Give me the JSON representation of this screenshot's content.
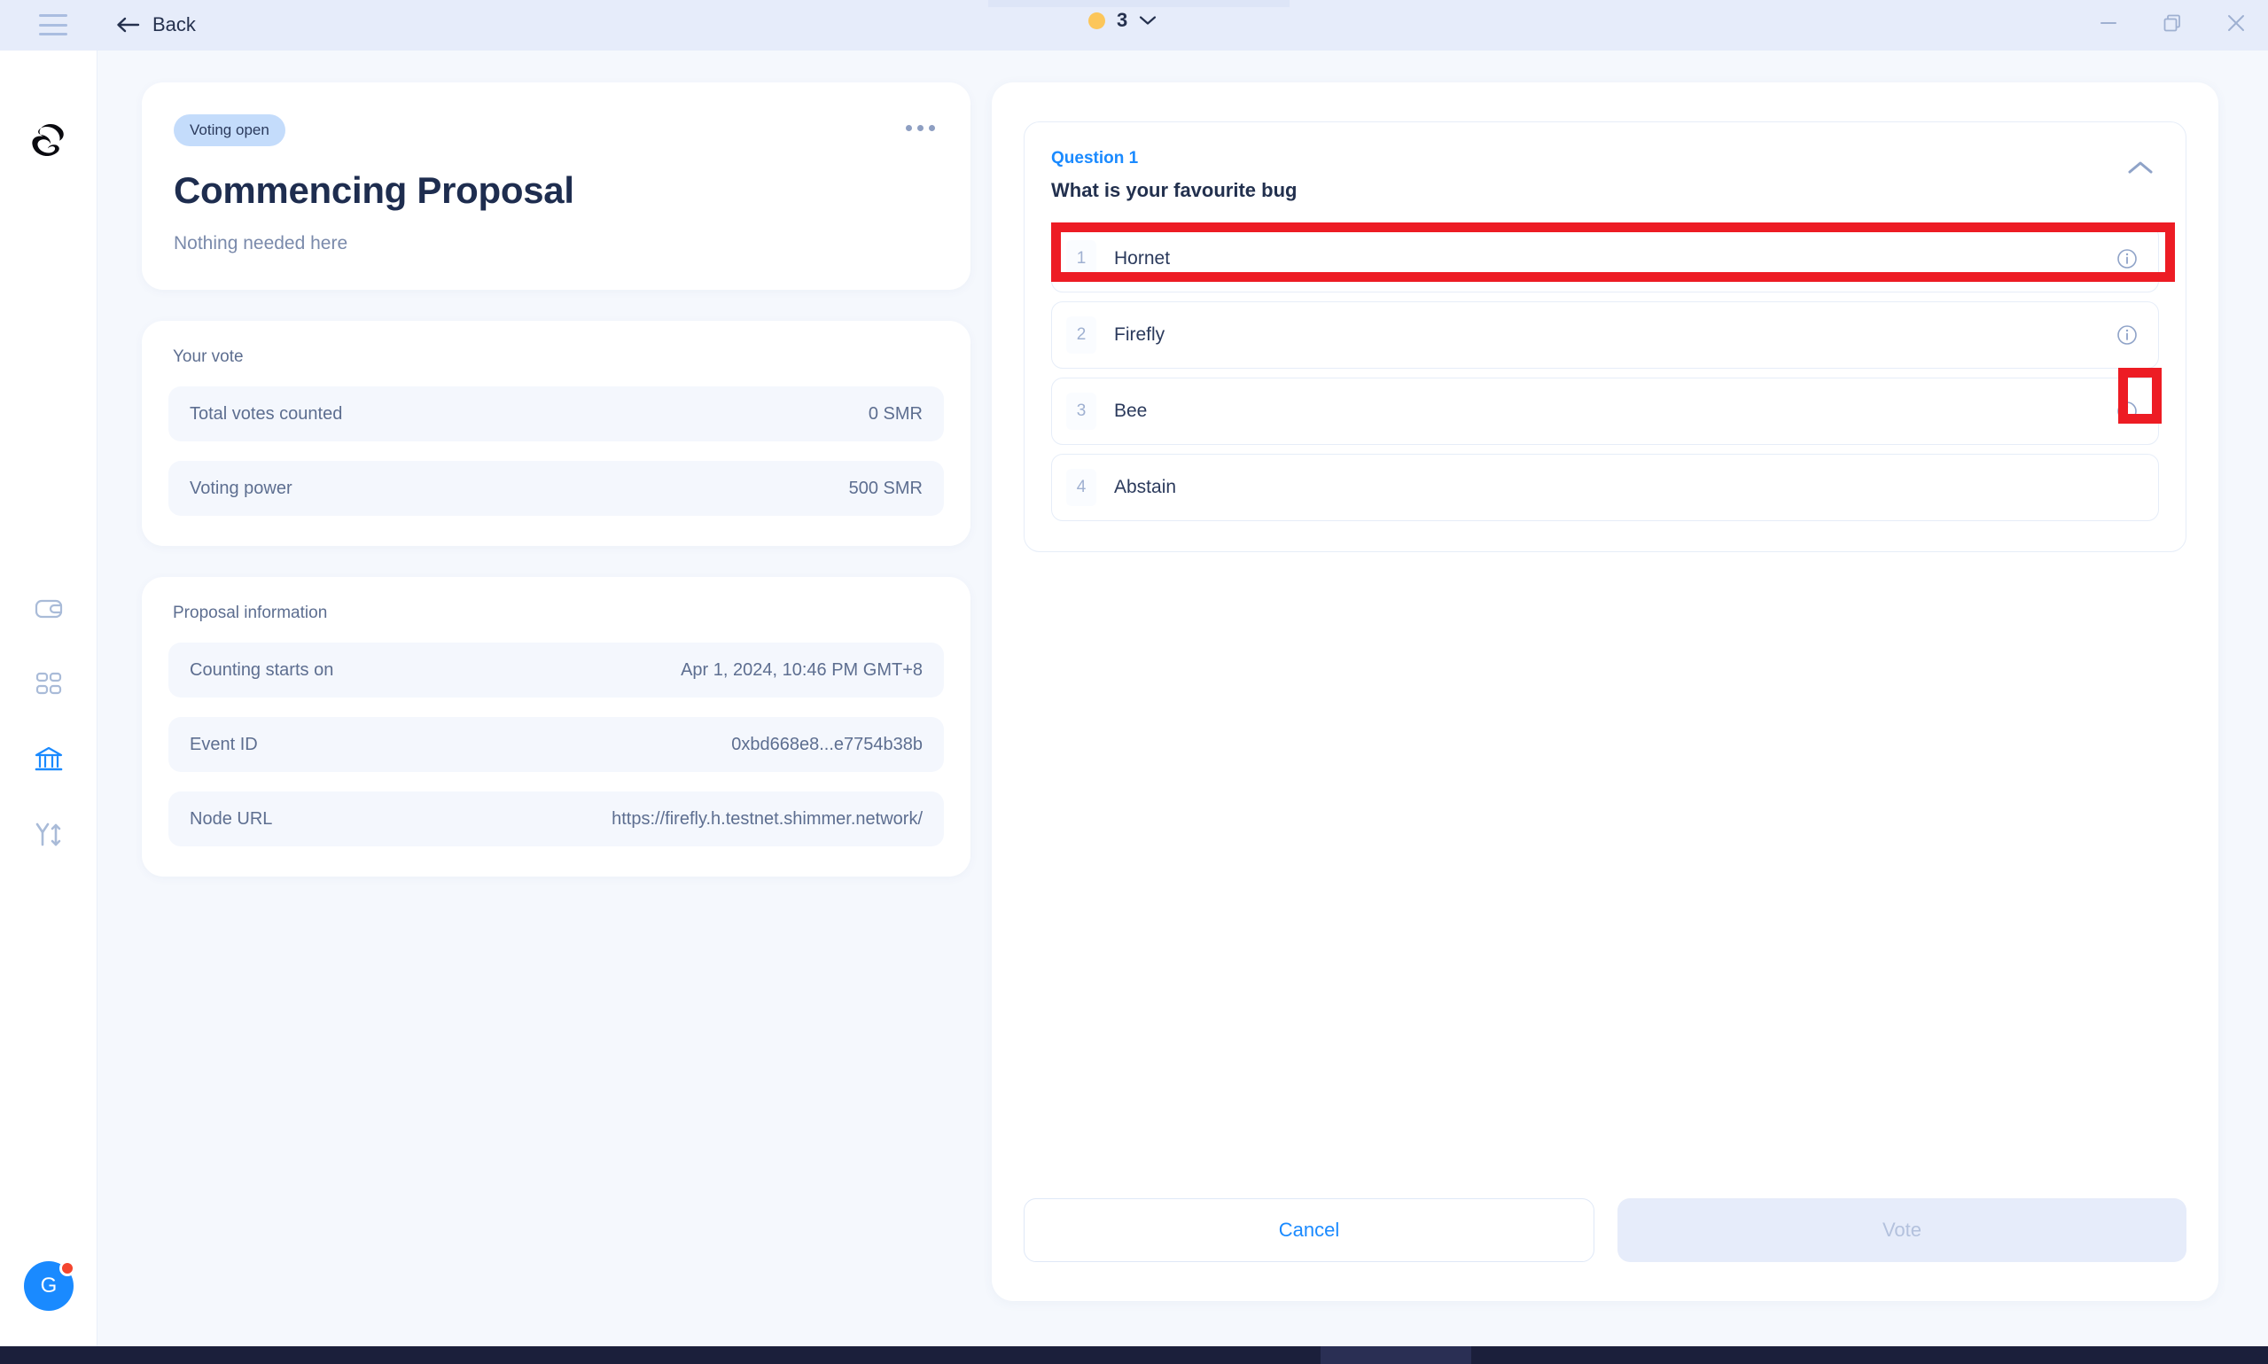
{
  "titlebar": {
    "menu_icon": "hamburger-icon",
    "back_label": "Back",
    "back_icon": "arrow-left-icon",
    "network_dot_color": "#fcc65a",
    "network_count": "3",
    "network_chevron_icon": "chevron-down-icon",
    "minimize_icon": "minimize-icon",
    "maximize_icon": "restore-icon",
    "close_icon": "close-icon"
  },
  "sidebar": {
    "logo_icon": "shimmer-logo-icon",
    "items": [
      {
        "icon": "wallet-icon",
        "name": "wallet",
        "active": false
      },
      {
        "icon": "apps-grid-icon",
        "name": "collectibles",
        "active": false
      },
      {
        "icon": "governance-bank-icon",
        "name": "governance",
        "active": true
      },
      {
        "icon": "settings-tools-icon",
        "name": "settings",
        "active": false
      }
    ],
    "avatar_initial": "G",
    "avatar_color": "#1a8aff",
    "avatar_badge_color": "#f4452f"
  },
  "proposal": {
    "status": "Voting open",
    "title": "Commencing Proposal",
    "subtitle": "Nothing needed here",
    "more_icon": "more-horizontal-icon"
  },
  "your_vote": {
    "title": "Your vote",
    "rows": [
      {
        "key": "Total votes counted",
        "value": "0 SMR"
      },
      {
        "key": "Voting power",
        "value": "500 SMR"
      }
    ]
  },
  "proposal_information": {
    "title": "Proposal information",
    "rows": [
      {
        "key": "Counting starts on",
        "value": "Apr 1, 2024, 10:46 PM GMT+8"
      },
      {
        "key": "Event ID",
        "value": "0xbd668e8...e7754b38b"
      },
      {
        "key": "Node URL",
        "value": "https://firefly.h.testnet.shimmer.network/"
      }
    ]
  },
  "question": {
    "label": "Question 1",
    "text": "What is your favourite bug",
    "collapse_icon": "chevron-up-icon",
    "answers": [
      {
        "num": "1",
        "text": "Hornet",
        "info_icon": "info-circle-icon",
        "has_info": true
      },
      {
        "num": "2",
        "text": "Firefly",
        "info_icon": "info-circle-icon",
        "has_info": true
      },
      {
        "num": "3",
        "text": "Bee",
        "info_icon": "info-circle-icon",
        "has_info": true
      },
      {
        "num": "4",
        "text": "Abstain",
        "info_icon": "",
        "has_info": false
      }
    ]
  },
  "actions": {
    "cancel_label": "Cancel",
    "vote_label": "Vote"
  },
  "annotations": {
    "color": "#ed1c24",
    "boxes": [
      {
        "name": "highlight-hornet-option"
      },
      {
        "name": "highlight-bee-info-icon"
      }
    ]
  }
}
